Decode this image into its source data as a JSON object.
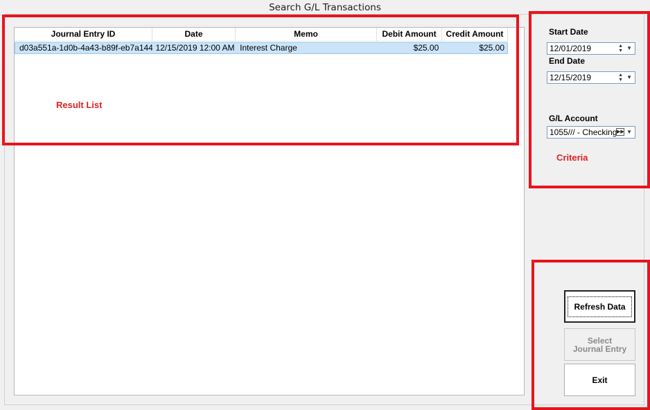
{
  "window": {
    "title": "Search G/L Transactions"
  },
  "results": {
    "columns": [
      "Journal Entry ID",
      "Date",
      "Memo",
      "Debit Amount",
      "Credit Amount"
    ],
    "rows": [
      {
        "id": "d03a551a-1d0b-4a43-b89f-eb7a144...",
        "date": "12/15/2019 12:00 AM",
        "memo": "Interest Charge",
        "debit": "$25.00",
        "credit": "$25.00"
      }
    ]
  },
  "criteria": {
    "start_label": "Start Date",
    "start_value": "12/01/2019",
    "end_label": "End Date",
    "end_value": "12/15/2019",
    "account_label": "G/L Account",
    "account_value": "1055/// - Checking"
  },
  "buttons": {
    "refresh": "Refresh Data",
    "select": "Select Journal Entry",
    "exit": "Exit"
  },
  "annotations": {
    "results": "Result List",
    "criteria": "Criteria"
  },
  "colors": {
    "annotation": "#e8141c",
    "selection": "#cce4f7"
  }
}
